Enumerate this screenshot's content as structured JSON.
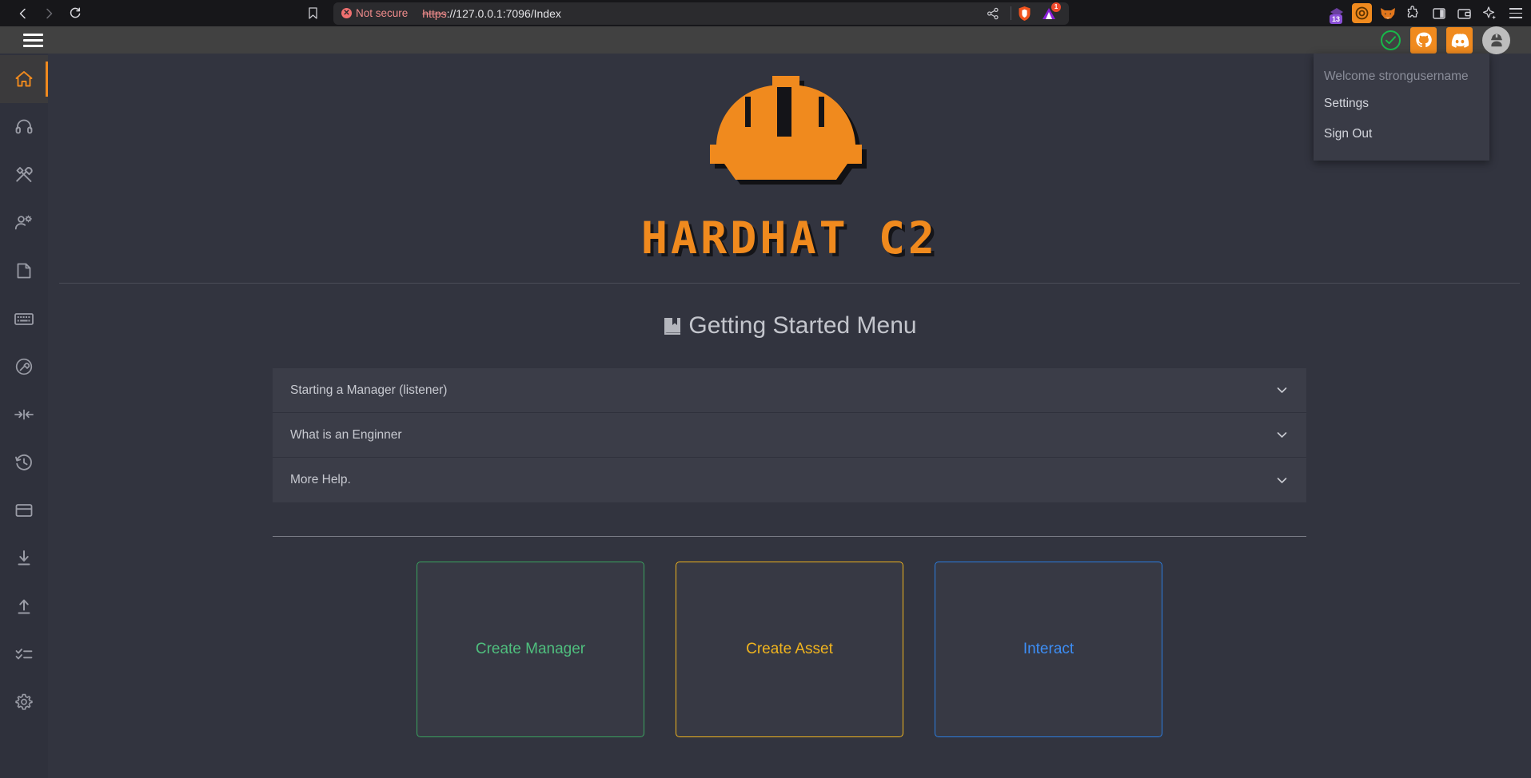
{
  "browser": {
    "back_icon": "back-arrow-icon",
    "forward_icon": "forward-arrow-icon",
    "reload_icon": "reload-icon",
    "bookmark_icon": "bookmark-icon",
    "security_label": "Not secure",
    "url_scheme": "https",
    "url_rest": "://127.0.0.1:7096/Index",
    "share_icon": "share-icon",
    "brave_icon": "brave-shields-icon",
    "shield_badge": "1",
    "extensions": [
      {
        "name": "privacy-badger-extension-icon",
        "badge": "13"
      },
      {
        "name": "ublock-origin-extension-icon",
        "badge": ""
      },
      {
        "name": "metamask-extension-icon",
        "badge": ""
      },
      {
        "name": "extensions-puzzle-icon",
        "badge": ""
      },
      {
        "name": "sidebar-toggle-icon",
        "badge": ""
      },
      {
        "name": "wallet-icon",
        "badge": ""
      },
      {
        "name": "leo-ai-sparkle-icon",
        "badge": ""
      }
    ],
    "menu_icon": "browser-menu-icon"
  },
  "app_header": {
    "menu_icon": "hamburger-menu-icon",
    "status_icon": "connection-ok-check-icon",
    "github_icon": "github-icon",
    "discord_icon": "discord-icon",
    "avatar_icon": "user-avatar-hardhat-icon"
  },
  "user_menu": {
    "welcome": "Welcome strongusername",
    "items": [
      {
        "label": "Settings"
      },
      {
        "label": "Sign Out"
      }
    ]
  },
  "sidebar": {
    "items": [
      {
        "name": "sidebar-item-home",
        "icon": "home-icon",
        "active": true
      },
      {
        "name": "sidebar-item-support",
        "icon": "headset-icon",
        "active": false
      },
      {
        "name": "sidebar-item-tools",
        "icon": "hammer-wrench-icon",
        "active": false
      },
      {
        "name": "sidebar-item-engineers",
        "icon": "user-gear-icon",
        "active": false
      },
      {
        "name": "sidebar-item-files",
        "icon": "file-icon",
        "active": false
      },
      {
        "name": "sidebar-item-keylogger",
        "icon": "keyboard-icon",
        "active": false
      },
      {
        "name": "sidebar-item-build",
        "icon": "wrench-circle-icon",
        "active": false
      },
      {
        "name": "sidebar-item-pivot",
        "icon": "arrows-collapse-icon",
        "active": false
      },
      {
        "name": "sidebar-item-history",
        "icon": "clock-history-icon",
        "active": false
      },
      {
        "name": "sidebar-item-credentials",
        "icon": "card-icon",
        "active": false
      },
      {
        "name": "sidebar-item-download",
        "icon": "download-icon",
        "active": false
      },
      {
        "name": "sidebar-item-upload",
        "icon": "upload-icon",
        "active": false
      },
      {
        "name": "sidebar-item-tasks",
        "icon": "checklist-icon",
        "active": false
      },
      {
        "name": "sidebar-item-settings",
        "icon": "gear-icon",
        "active": false
      }
    ]
  },
  "main": {
    "logo_alt": "hardhat-logo-icon",
    "logo_text": "HARDHAT C2",
    "section_icon": "book-icon",
    "section_title": "Getting Started Menu",
    "accordion": [
      {
        "label": "Starting a Manager (listener)",
        "chevron": "chevron-down-icon"
      },
      {
        "label": "What is an Enginner",
        "chevron": "chevron-down-icon"
      },
      {
        "label": "More Help.",
        "chevron": "chevron-down-icon"
      }
    ],
    "cards": [
      {
        "label": "Create Manager",
        "color": "#4fbf7e"
      },
      {
        "label": "Create Asset",
        "color": "#f0b41e"
      },
      {
        "label": "Interact",
        "color": "#3d8ef5"
      }
    ]
  },
  "colors": {
    "accent_orange": "#f08a1e",
    "page_bg": "#32343f",
    "panel_bg": "#3b3d48",
    "sidebar_bg": "#2f313c",
    "header_bg": "#414141",
    "green": "#18b84a"
  }
}
